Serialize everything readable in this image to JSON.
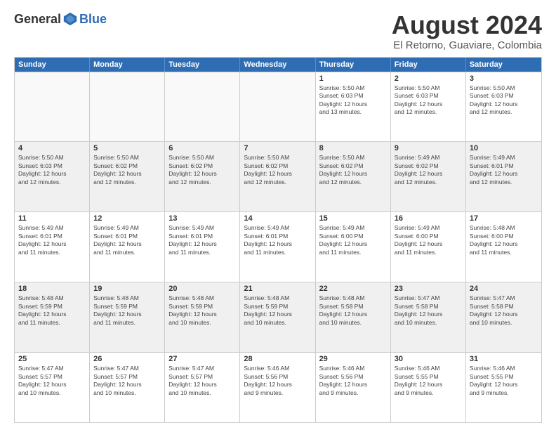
{
  "logo": {
    "general": "General",
    "blue": "Blue"
  },
  "title": "August 2024",
  "subtitle": "El Retorno, Guaviare, Colombia",
  "headers": [
    "Sunday",
    "Monday",
    "Tuesday",
    "Wednesday",
    "Thursday",
    "Friday",
    "Saturday"
  ],
  "rows": [
    [
      {
        "day": "",
        "lines": []
      },
      {
        "day": "",
        "lines": []
      },
      {
        "day": "",
        "lines": []
      },
      {
        "day": "",
        "lines": []
      },
      {
        "day": "1",
        "lines": [
          "Sunrise: 5:50 AM",
          "Sunset: 6:03 PM",
          "Daylight: 12 hours",
          "and 13 minutes."
        ]
      },
      {
        "day": "2",
        "lines": [
          "Sunrise: 5:50 AM",
          "Sunset: 6:03 PM",
          "Daylight: 12 hours",
          "and 12 minutes."
        ]
      },
      {
        "day": "3",
        "lines": [
          "Sunrise: 5:50 AM",
          "Sunset: 6:03 PM",
          "Daylight: 12 hours",
          "and 12 minutes."
        ]
      }
    ],
    [
      {
        "day": "4",
        "lines": [
          "Sunrise: 5:50 AM",
          "Sunset: 6:03 PM",
          "Daylight: 12 hours",
          "and 12 minutes."
        ]
      },
      {
        "day": "5",
        "lines": [
          "Sunrise: 5:50 AM",
          "Sunset: 6:02 PM",
          "Daylight: 12 hours",
          "and 12 minutes."
        ]
      },
      {
        "day": "6",
        "lines": [
          "Sunrise: 5:50 AM",
          "Sunset: 6:02 PM",
          "Daylight: 12 hours",
          "and 12 minutes."
        ]
      },
      {
        "day": "7",
        "lines": [
          "Sunrise: 5:50 AM",
          "Sunset: 6:02 PM",
          "Daylight: 12 hours",
          "and 12 minutes."
        ]
      },
      {
        "day": "8",
        "lines": [
          "Sunrise: 5:50 AM",
          "Sunset: 6:02 PM",
          "Daylight: 12 hours",
          "and 12 minutes."
        ]
      },
      {
        "day": "9",
        "lines": [
          "Sunrise: 5:49 AM",
          "Sunset: 6:02 PM",
          "Daylight: 12 hours",
          "and 12 minutes."
        ]
      },
      {
        "day": "10",
        "lines": [
          "Sunrise: 5:49 AM",
          "Sunset: 6:01 PM",
          "Daylight: 12 hours",
          "and 12 minutes."
        ]
      }
    ],
    [
      {
        "day": "11",
        "lines": [
          "Sunrise: 5:49 AM",
          "Sunset: 6:01 PM",
          "Daylight: 12 hours",
          "and 11 minutes."
        ]
      },
      {
        "day": "12",
        "lines": [
          "Sunrise: 5:49 AM",
          "Sunset: 6:01 PM",
          "Daylight: 12 hours",
          "and 11 minutes."
        ]
      },
      {
        "day": "13",
        "lines": [
          "Sunrise: 5:49 AM",
          "Sunset: 6:01 PM",
          "Daylight: 12 hours",
          "and 11 minutes."
        ]
      },
      {
        "day": "14",
        "lines": [
          "Sunrise: 5:49 AM",
          "Sunset: 6:01 PM",
          "Daylight: 12 hours",
          "and 11 minutes."
        ]
      },
      {
        "day": "15",
        "lines": [
          "Sunrise: 5:49 AM",
          "Sunset: 6:00 PM",
          "Daylight: 12 hours",
          "and 11 minutes."
        ]
      },
      {
        "day": "16",
        "lines": [
          "Sunrise: 5:49 AM",
          "Sunset: 6:00 PM",
          "Daylight: 12 hours",
          "and 11 minutes."
        ]
      },
      {
        "day": "17",
        "lines": [
          "Sunrise: 5:48 AM",
          "Sunset: 6:00 PM",
          "Daylight: 12 hours",
          "and 11 minutes."
        ]
      }
    ],
    [
      {
        "day": "18",
        "lines": [
          "Sunrise: 5:48 AM",
          "Sunset: 5:59 PM",
          "Daylight: 12 hours",
          "and 11 minutes."
        ]
      },
      {
        "day": "19",
        "lines": [
          "Sunrise: 5:48 AM",
          "Sunset: 5:59 PM",
          "Daylight: 12 hours",
          "and 11 minutes."
        ]
      },
      {
        "day": "20",
        "lines": [
          "Sunrise: 5:48 AM",
          "Sunset: 5:59 PM",
          "Daylight: 12 hours",
          "and 10 minutes."
        ]
      },
      {
        "day": "21",
        "lines": [
          "Sunrise: 5:48 AM",
          "Sunset: 5:59 PM",
          "Daylight: 12 hours",
          "and 10 minutes."
        ]
      },
      {
        "day": "22",
        "lines": [
          "Sunrise: 5:48 AM",
          "Sunset: 5:58 PM",
          "Daylight: 12 hours",
          "and 10 minutes."
        ]
      },
      {
        "day": "23",
        "lines": [
          "Sunrise: 5:47 AM",
          "Sunset: 5:58 PM",
          "Daylight: 12 hours",
          "and 10 minutes."
        ]
      },
      {
        "day": "24",
        "lines": [
          "Sunrise: 5:47 AM",
          "Sunset: 5:58 PM",
          "Daylight: 12 hours",
          "and 10 minutes."
        ]
      }
    ],
    [
      {
        "day": "25",
        "lines": [
          "Sunrise: 5:47 AM",
          "Sunset: 5:57 PM",
          "Daylight: 12 hours",
          "and 10 minutes."
        ]
      },
      {
        "day": "26",
        "lines": [
          "Sunrise: 5:47 AM",
          "Sunset: 5:57 PM",
          "Daylight: 12 hours",
          "and 10 minutes."
        ]
      },
      {
        "day": "27",
        "lines": [
          "Sunrise: 5:47 AM",
          "Sunset: 5:57 PM",
          "Daylight: 12 hours",
          "and 10 minutes."
        ]
      },
      {
        "day": "28",
        "lines": [
          "Sunrise: 5:46 AM",
          "Sunset: 5:56 PM",
          "Daylight: 12 hours",
          "and 9 minutes."
        ]
      },
      {
        "day": "29",
        "lines": [
          "Sunrise: 5:46 AM",
          "Sunset: 5:56 PM",
          "Daylight: 12 hours",
          "and 9 minutes."
        ]
      },
      {
        "day": "30",
        "lines": [
          "Sunrise: 5:46 AM",
          "Sunset: 5:55 PM",
          "Daylight: 12 hours",
          "and 9 minutes."
        ]
      },
      {
        "day": "31",
        "lines": [
          "Sunrise: 5:46 AM",
          "Sunset: 5:55 PM",
          "Daylight: 12 hours",
          "and 9 minutes."
        ]
      }
    ]
  ]
}
